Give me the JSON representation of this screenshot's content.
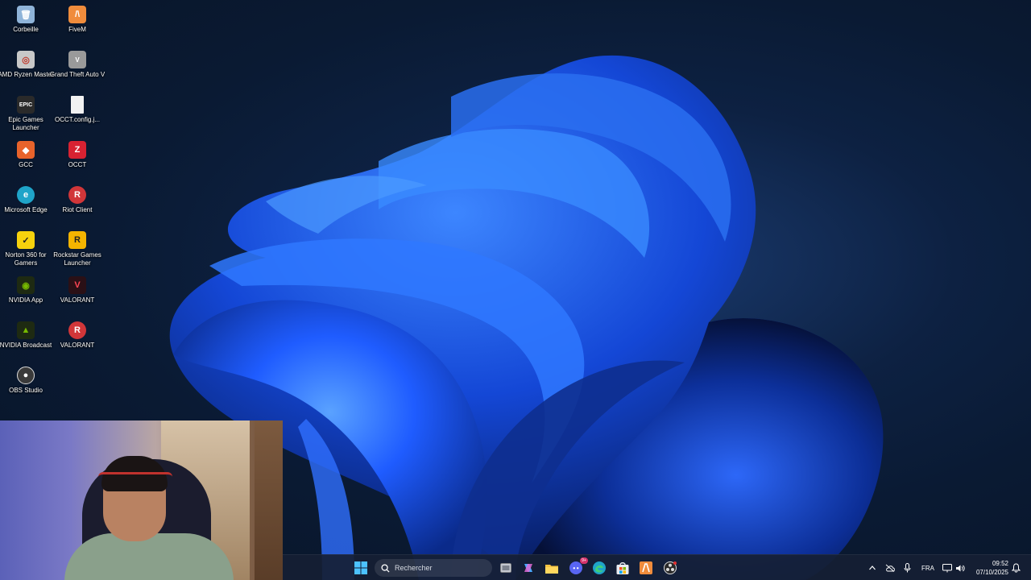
{
  "desktop": {
    "icons": [
      {
        "label": "Corbeille",
        "icon": "recycle-bin-icon",
        "color": "#8fb4d9"
      },
      {
        "label": "FiveM",
        "icon": "fivem-icon",
        "color": "#f08c3c"
      },
      {
        "label": "AMD Ryzen Master",
        "icon": "amd-ryzen-master-icon",
        "color": "#c8c8c8"
      },
      {
        "label": "Grand Theft Auto V",
        "icon": "gta-v-icon",
        "color": "#9a9a9a"
      },
      {
        "label": "Epic Games Launcher",
        "icon": "epic-games-icon",
        "color": "#2a2a2a"
      },
      {
        "label": "OCCT.config.j...",
        "icon": "file-icon",
        "color": "#f2f2f2"
      },
      {
        "label": "GCC",
        "icon": "gcc-icon",
        "color": "#e8632b"
      },
      {
        "label": "OCCT",
        "icon": "occt-icon",
        "color": "#d82232"
      },
      {
        "label": "Microsoft Edge",
        "icon": "edge-icon",
        "color": "#1fa4c9"
      },
      {
        "label": "Riot Client",
        "icon": "riot-client-icon",
        "color": "#d13639"
      },
      {
        "label": "Norton 360 for Gamers",
        "icon": "norton-icon",
        "color": "#f6d20d"
      },
      {
        "label": "Rockstar Games Launcher",
        "icon": "rockstar-icon",
        "color": "#f4b400"
      },
      {
        "label": "NVIDIA App",
        "icon": "nvidia-app-icon",
        "color": "#1e2a12"
      },
      {
        "label": "VALORANT",
        "icon": "valorant-icon",
        "color": "#2a1016"
      },
      {
        "label": "NVIDIA Broadcast",
        "icon": "nvidia-broadcast-icon",
        "color": "#1e2a12"
      },
      {
        "label": "VALORANT",
        "icon": "valorant-riot-icon",
        "color": "#d13639"
      },
      {
        "label": "OBS Studio",
        "icon": "obs-icon",
        "color": "#3a3a3a"
      }
    ]
  },
  "taskbar": {
    "search_placeholder": "Rechercher",
    "apps": [
      {
        "name": "start-button",
        "icon": "windows-icon"
      },
      {
        "name": "task-view-button",
        "icon": "task-view-icon"
      },
      {
        "name": "copilot-button",
        "icon": "copilot-icon"
      },
      {
        "name": "file-explorer-button",
        "icon": "folder-icon"
      },
      {
        "name": "discord-button",
        "icon": "discord-icon",
        "badge": "9+"
      },
      {
        "name": "edge-button",
        "icon": "edge-icon"
      },
      {
        "name": "store-button",
        "icon": "store-icon"
      },
      {
        "name": "fivem-button",
        "icon": "fivem-icon"
      },
      {
        "name": "obs-button",
        "icon": "obs-icon"
      }
    ],
    "tray": {
      "language": "FRA",
      "time": "09:52",
      "date": "07/10/2025"
    }
  },
  "colors": {
    "accent": "#1f5cff",
    "taskbar_bg": "#162034"
  }
}
